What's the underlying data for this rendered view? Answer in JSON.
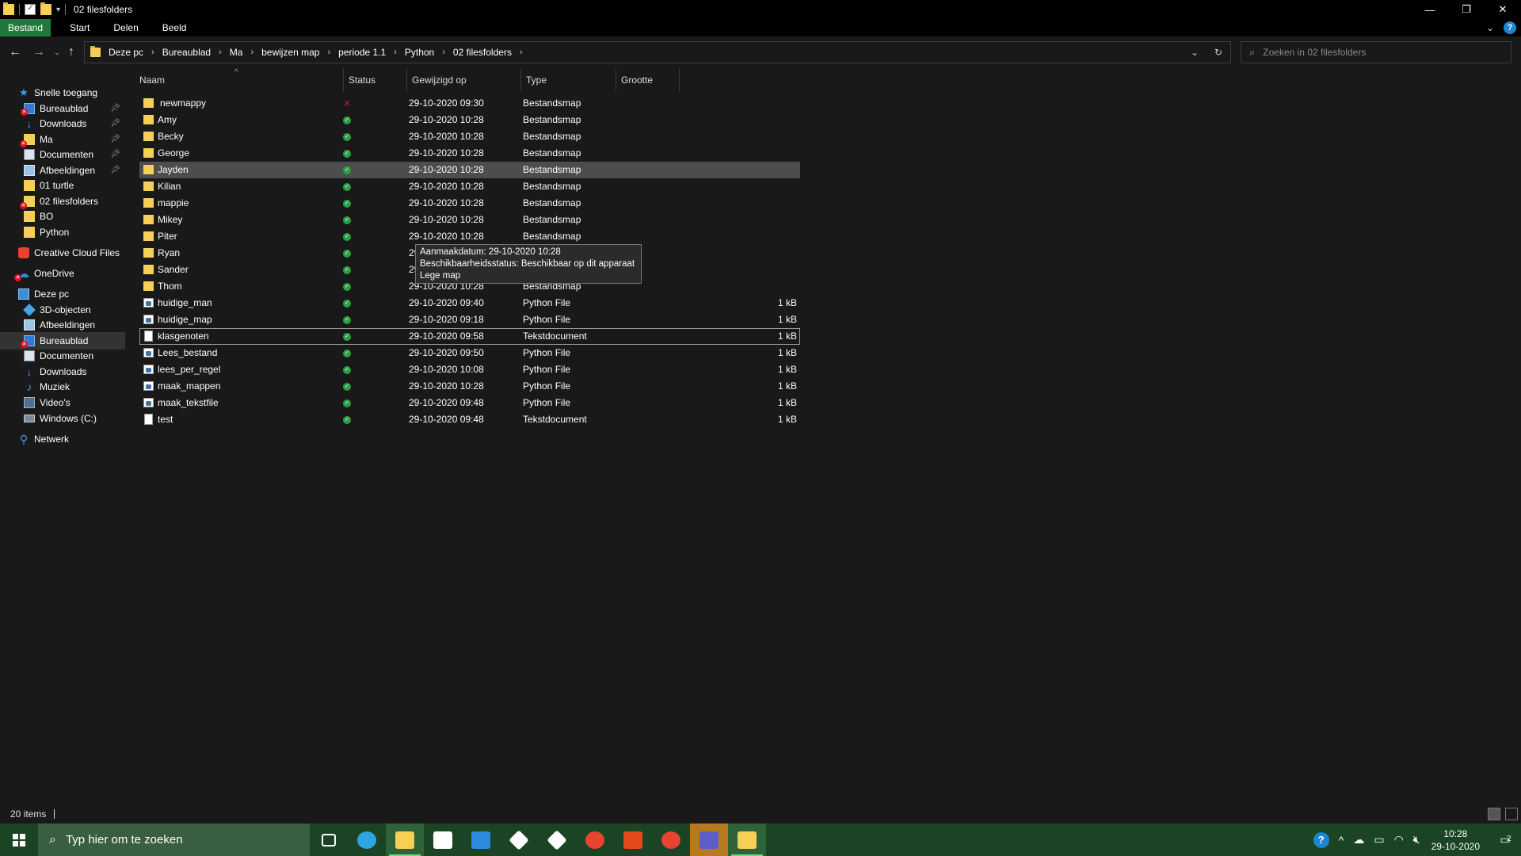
{
  "window": {
    "title": "02 filesfolders",
    "controls": [
      "—",
      "❐",
      "✕"
    ]
  },
  "ribbon": {
    "tabs": [
      "Bestand",
      "Start",
      "Delen",
      "Beeld"
    ]
  },
  "address": {
    "crumbs": [
      "Deze pc",
      "Bureaublad",
      "Ma",
      "bewijzen map",
      "periode 1.1",
      "Python",
      "02 filesfolders"
    ],
    "search_placeholder": "Zoeken in 02 filesfolders"
  },
  "nav": {
    "items": [
      {
        "label": "Snelle toegang",
        "icon": "star-icon",
        "indent": 0,
        "pinned": false,
        "error": false
      },
      {
        "label": "Bureaublad",
        "icon": "desktop-icon",
        "indent": 1,
        "pinned": true,
        "error": true
      },
      {
        "label": "Downloads",
        "icon": "download-icon",
        "indent": 1,
        "pinned": true,
        "error": false
      },
      {
        "label": "Ma",
        "icon": "folder-icon",
        "indent": 1,
        "pinned": true,
        "error": true
      },
      {
        "label": "Documenten",
        "icon": "document-icon",
        "indent": 1,
        "pinned": true,
        "error": false
      },
      {
        "label": "Afbeeldingen",
        "icon": "pictures-icon",
        "indent": 1,
        "pinned": true,
        "error": false
      },
      {
        "label": "01 turtle",
        "icon": "folder-icon",
        "indent": 1,
        "pinned": false,
        "error": false
      },
      {
        "label": "02 filesfolders",
        "icon": "folder-icon",
        "indent": 1,
        "pinned": false,
        "error": true
      },
      {
        "label": "BO",
        "icon": "folder-icon",
        "indent": 1,
        "pinned": false,
        "error": false
      },
      {
        "label": "Python",
        "icon": "folder-icon",
        "indent": 1,
        "pinned": false,
        "error": false
      },
      {
        "label": "Creative Cloud Files",
        "icon": "creative-cloud-icon",
        "indent": 0,
        "pinned": false,
        "error": false
      },
      {
        "label": "OneDrive",
        "icon": "onedrive-icon",
        "indent": 0,
        "pinned": false,
        "error": true
      },
      {
        "label": "Deze pc",
        "icon": "pc-icon",
        "indent": 0,
        "pinned": false,
        "error": false
      },
      {
        "label": "3D-objecten",
        "icon": "3d-objects-icon",
        "indent": 1,
        "pinned": false,
        "error": false
      },
      {
        "label": "Afbeeldingen",
        "icon": "pictures-icon",
        "indent": 1,
        "pinned": false,
        "error": false
      },
      {
        "label": "Bureaublad",
        "icon": "desktop-icon",
        "indent": 1,
        "pinned": false,
        "error": true,
        "selected": true
      },
      {
        "label": "Documenten",
        "icon": "document-icon",
        "indent": 1,
        "pinned": false,
        "error": false
      },
      {
        "label": "Downloads",
        "icon": "download-icon",
        "indent": 1,
        "pinned": false,
        "error": false
      },
      {
        "label": "Muziek",
        "icon": "music-icon",
        "indent": 1,
        "pinned": false,
        "error": false
      },
      {
        "label": "Video's",
        "icon": "video-icon",
        "indent": 1,
        "pinned": false,
        "error": false
      },
      {
        "label": "Windows (C:)",
        "icon": "drive-icon",
        "indent": 1,
        "pinned": false,
        "error": false
      },
      {
        "label": "Netwerk",
        "icon": "network-icon",
        "indent": 0,
        "pinned": false,
        "error": false
      }
    ]
  },
  "columns": [
    "Naam",
    "Status",
    "Gewijzigd op",
    "Type",
    "Grootte"
  ],
  "files": [
    {
      "name": "newmappy",
      "kind": "folder",
      "status": "error",
      "modified": "29-10-2020 09:30",
      "type": "Bestandsmap",
      "size": ""
    },
    {
      "name": "Amy",
      "kind": "folder",
      "status": "ok",
      "modified": "29-10-2020 10:28",
      "type": "Bestandsmap",
      "size": ""
    },
    {
      "name": "Becky",
      "kind": "folder",
      "status": "ok",
      "modified": "29-10-2020 10:28",
      "type": "Bestandsmap",
      "size": ""
    },
    {
      "name": "George",
      "kind": "folder",
      "status": "ok",
      "modified": "29-10-2020 10:28",
      "type": "Bestandsmap",
      "size": ""
    },
    {
      "name": "Jayden",
      "kind": "folder",
      "status": "ok",
      "modified": "29-10-2020 10:28",
      "type": "Bestandsmap",
      "size": "",
      "selected": true
    },
    {
      "name": "Kilian",
      "kind": "folder",
      "status": "ok",
      "modified": "29-10-2020 10:28",
      "type": "Bestandsmap",
      "size": ""
    },
    {
      "name": "mappie",
      "kind": "folder",
      "status": "ok",
      "modified": "29-10-2020 10:28",
      "type": "Bestandsmap",
      "size": ""
    },
    {
      "name": "Mikey",
      "kind": "folder",
      "status": "ok",
      "modified": "29-10-2020 10:28",
      "type": "Bestandsmap",
      "size": ""
    },
    {
      "name": "Piter",
      "kind": "folder",
      "status": "ok",
      "modified": "29-10-2020 10:28",
      "type": "Bestandsmap",
      "size": ""
    },
    {
      "name": "Ryan",
      "kind": "folder",
      "status": "ok",
      "modified": "29-10-2020 10:28",
      "type": "Bestandsmap",
      "size": ""
    },
    {
      "name": "Sander",
      "kind": "folder",
      "status": "ok",
      "modified": "29-10-2020 10:28",
      "type": "Bestandsmap",
      "size": ""
    },
    {
      "name": "Thom",
      "kind": "folder",
      "status": "ok",
      "modified": "29-10-2020 10:28",
      "type": "Bestandsmap",
      "size": ""
    },
    {
      "name": "huidige_man",
      "kind": "py",
      "status": "ok",
      "modified": "29-10-2020 09:40",
      "type": "Python File",
      "size": "1 kB"
    },
    {
      "name": "huidige_map",
      "kind": "py",
      "status": "ok",
      "modified": "29-10-2020 09:18",
      "type": "Python File",
      "size": "1 kB"
    },
    {
      "name": "klasgenoten",
      "kind": "txt",
      "status": "ok",
      "modified": "29-10-2020 09:58",
      "type": "Tekstdocument",
      "size": "1 kB",
      "focused": true
    },
    {
      "name": "Lees_bestand",
      "kind": "py",
      "status": "ok",
      "modified": "29-10-2020 09:50",
      "type": "Python File",
      "size": "1 kB"
    },
    {
      "name": "lees_per_regel",
      "kind": "py",
      "status": "ok",
      "modified": "29-10-2020 10:08",
      "type": "Python File",
      "size": "1 kB"
    },
    {
      "name": "maak_mappen",
      "kind": "py",
      "status": "ok",
      "modified": "29-10-2020 10:28",
      "type": "Python File",
      "size": "1 kB"
    },
    {
      "name": "maak_tekstfile",
      "kind": "py",
      "status": "ok",
      "modified": "29-10-2020 09:48",
      "type": "Python File",
      "size": "1 kB"
    },
    {
      "name": "test",
      "kind": "txt",
      "status": "ok",
      "modified": "29-10-2020 09:48",
      "type": "Tekstdocument",
      "size": "1 kB"
    }
  ],
  "tooltip": {
    "line1": "Aanmaakdatum: 29-10-2020 10:28",
    "line2": "Beschikbaarheidsstatus: Beschikbaar op dit apparaat",
    "line3": "Lege map"
  },
  "status": {
    "count": "20 items"
  },
  "taskbar": {
    "search_placeholder": "Typ hier om te zoeken",
    "apps": [
      {
        "name": "task-view-icon",
        "color": "#ffffff"
      },
      {
        "name": "edge-icon",
        "color": "#2fa5e0"
      },
      {
        "name": "file-explorer-icon",
        "color": "#f6cf56",
        "active": true
      },
      {
        "name": "store-icon",
        "color": "#ffffff"
      },
      {
        "name": "mail-icon",
        "color": "#2c8bde"
      },
      {
        "name": "dropbox-icon",
        "color": "#ffffff"
      },
      {
        "name": "winamp-icon",
        "color": "#ffffff"
      },
      {
        "name": "chrome-icon",
        "color": "#e8432f"
      },
      {
        "name": "office-icon",
        "color": "#e54a1f"
      },
      {
        "name": "chrome-profile-icon",
        "color": "#e8432f"
      },
      {
        "name": "teams-icon",
        "color": "#5b5fc7",
        "highlight": true
      },
      {
        "name": "python-file-icon",
        "color": "#f6cf56",
        "active": true
      }
    ],
    "clock_time": "10:28",
    "clock_date": "29-10-2020",
    "notification_count": "2"
  }
}
